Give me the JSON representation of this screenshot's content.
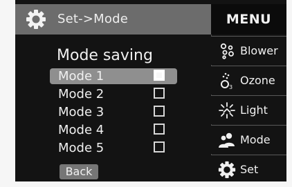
{
  "header": {
    "title": "Set->Mode",
    "icon": "gear-icon",
    "menu_label": "MENU"
  },
  "panel": {
    "title": "Mode saving",
    "modes": [
      {
        "label": "Mode 1",
        "selected": true,
        "checked": true
      },
      {
        "label": "Mode 2",
        "selected": false,
        "checked": false
      },
      {
        "label": "Mode 3",
        "selected": false,
        "checked": false
      },
      {
        "label": "Mode 4",
        "selected": false,
        "checked": false
      },
      {
        "label": "Mode 5",
        "selected": false,
        "checked": false
      }
    ],
    "back_label": "Back"
  },
  "sidebar": {
    "items": [
      {
        "label": "Blower",
        "icon": "blower-icon"
      },
      {
        "label": "Ozone",
        "icon": "ozone-icon"
      },
      {
        "label": "Light",
        "icon": "light-icon"
      },
      {
        "label": "Mode",
        "icon": "mode-icon"
      },
      {
        "label": "Set",
        "icon": "gear-icon"
      }
    ]
  },
  "colors": {
    "screen_bg": "#131313",
    "header_bg": "#6c6c6c",
    "highlight_bg": "#8f8f8f",
    "text": "#f0f0f0"
  }
}
